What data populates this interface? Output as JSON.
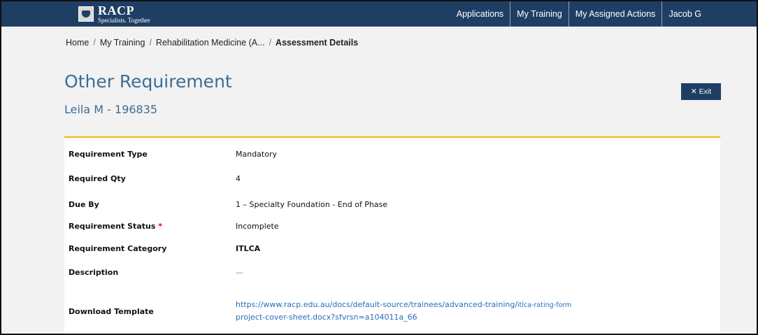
{
  "header": {
    "logo_name": "RACP",
    "logo_tagline": "Specialists. Together",
    "nav": [
      "Applications",
      "My Training",
      "My Assigned Actions",
      "Jacob G"
    ]
  },
  "breadcrumb": {
    "home": "Home",
    "my_training": "My Training",
    "program": "Rehabilitation Medicine (A...",
    "current": "Assessment Details"
  },
  "page": {
    "title": "Other Requirement",
    "subtitle": "Leila M - 196835",
    "exit_label": "Exit"
  },
  "details": {
    "requirement_type_label": "Requirement Type",
    "requirement_type_value": "Mandatory",
    "required_qty_label": "Required Qty",
    "required_qty_value": "4",
    "due_by_label": "Due By",
    "due_by_value": "1 – Specialty Foundation - End of Phase",
    "status_label": "Requirement Status",
    "status_value": "Incomplete",
    "category_label": "Requirement Category",
    "category_value": "ITLCA",
    "description_label": "Description",
    "description_value": "—",
    "download_label": "Download Template",
    "download_link_main": "https://www.racp.edu.au/docs/default-source/trainees/advanced-training/",
    "download_link_small": "itlca-rating-form",
    "download_link_line2": "project-cover-sheet.docx?sfvrsn=a104011a_66"
  }
}
